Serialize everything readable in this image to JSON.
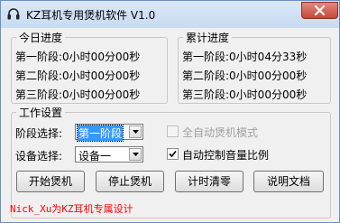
{
  "window": {
    "title": "KZ耳机专用煲机软件 V1.0"
  },
  "today": {
    "title": "今日进度",
    "rows": [
      {
        "label": "第一阶段:",
        "value": "0小时00分00秒"
      },
      {
        "label": "第二阶段:",
        "value": "0小时00分00秒"
      },
      {
        "label": "第三阶段:",
        "value": "0小时00分00秒"
      }
    ]
  },
  "total": {
    "title": "累计进度",
    "rows": [
      {
        "label": "第一阶段:",
        "value": "0小时04分33秒"
      },
      {
        "label": "第二阶段:",
        "value": "0小时00分00秒"
      },
      {
        "label": "第三阶段:",
        "value": "0小时00分00秒"
      }
    ]
  },
  "settings": {
    "title": "工作设置",
    "stage_label": "阶段选择:",
    "stage_value": "第一阶段",
    "device_label": "设备选择:",
    "device_value": "设备一",
    "auto_mode_label": "全自动煲机模式",
    "auto_mode_checked": false,
    "auto_mode_enabled": false,
    "auto_volume_label": "自动控制音量比例",
    "auto_volume_checked": true
  },
  "buttons": {
    "start": "开始煲机",
    "stop": "停止煲机",
    "reset": "计时清零",
    "docs": "说明文档"
  },
  "footer": {
    "credit": "Nick_Xu为KZ耳机专属设计"
  },
  "colors": {
    "footer_text": "#ff0000",
    "selection": "#3399ff",
    "close_button": "#c6473a"
  }
}
